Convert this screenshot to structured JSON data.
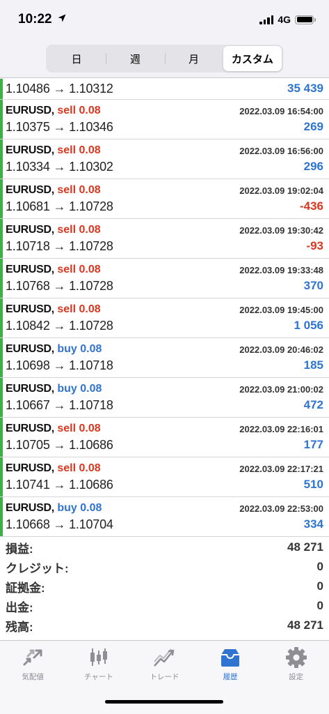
{
  "status_bar": {
    "time": "10:22",
    "network": "4G"
  },
  "segments": [
    {
      "label": "日",
      "active": false
    },
    {
      "label": "週",
      "active": false
    },
    {
      "label": "月",
      "active": false
    },
    {
      "label": "カスタム",
      "active": true
    }
  ],
  "first_row": {
    "prices": "1.10486 → 1.10312",
    "profit": "35 439"
  },
  "deals": [
    {
      "symbol": "EURUSD,",
      "type": "sell 0.08",
      "side": "sell",
      "time": "2022.03.09 16:54:00",
      "prices": "1.10375 → 1.10346",
      "profit": "269"
    },
    {
      "symbol": "EURUSD,",
      "type": "sell 0.08",
      "side": "sell",
      "time": "2022.03.09 16:56:00",
      "prices": "1.10334 → 1.10302",
      "profit": "296"
    },
    {
      "symbol": "EURUSD,",
      "type": "sell 0.08",
      "side": "sell",
      "time": "2022.03.09 19:02:04",
      "prices": "1.10681 → 1.10728",
      "profit": "-436"
    },
    {
      "symbol": "EURUSD,",
      "type": "sell 0.08",
      "side": "sell",
      "time": "2022.03.09 19:30:42",
      "prices": "1.10718 → 1.10728",
      "profit": "-93"
    },
    {
      "symbol": "EURUSD,",
      "type": "sell 0.08",
      "side": "sell",
      "time": "2022.03.09 19:33:48",
      "prices": "1.10768 → 1.10728",
      "profit": "370"
    },
    {
      "symbol": "EURUSD,",
      "type": "sell 0.08",
      "side": "sell",
      "time": "2022.03.09 19:45:00",
      "prices": "1.10842 → 1.10728",
      "profit": "1 056"
    },
    {
      "symbol": "EURUSD,",
      "type": "buy 0.08",
      "side": "buy",
      "time": "2022.03.09 20:46:02",
      "prices": "1.10698 → 1.10718",
      "profit": "185"
    },
    {
      "symbol": "EURUSD,",
      "type": "buy 0.08",
      "side": "buy",
      "time": "2022.03.09 21:00:02",
      "prices": "1.10667 → 1.10718",
      "profit": "472"
    },
    {
      "symbol": "EURUSD,",
      "type": "sell 0.08",
      "side": "sell",
      "time": "2022.03.09 22:16:01",
      "prices": "1.10705 → 1.10686",
      "profit": "177"
    },
    {
      "symbol": "EURUSD,",
      "type": "sell 0.08",
      "side": "sell",
      "time": "2022.03.09 22:17:21",
      "prices": "1.10741 → 1.10686",
      "profit": "510"
    },
    {
      "symbol": "EURUSD,",
      "type": "buy 0.08",
      "side": "buy",
      "time": "2022.03.09 22:53:00",
      "prices": "1.10668 → 1.10704",
      "profit": "334"
    }
  ],
  "summary": {
    "profit_label": "損益:",
    "profit_value": "48 271",
    "credit_label": "クレジット:",
    "credit_value": "0",
    "margin_label": "証拠金:",
    "margin_value": "0",
    "withdrawal_label": "出金:",
    "withdrawal_value": "0",
    "balance_label": "残高:",
    "balance_value": "48 271"
  },
  "tabbar": {
    "items": [
      {
        "label": "気配値",
        "icon": "quotes-icon"
      },
      {
        "label": "チャート",
        "icon": "chart-icon"
      },
      {
        "label": "トレード",
        "icon": "trade-icon"
      },
      {
        "label": "履歴",
        "icon": "history-icon"
      },
      {
        "label": "設定",
        "icon": "settings-icon"
      }
    ],
    "active_index": 3
  },
  "colors": {
    "sell": "#d9371f",
    "buy": "#2f74d0",
    "profit_positive": "#2f74d0",
    "profit_negative": "#d9371f",
    "side_bar": "#3cb043",
    "active_tab": "#2f74d0",
    "inactive_tab": "#8e8e93"
  }
}
